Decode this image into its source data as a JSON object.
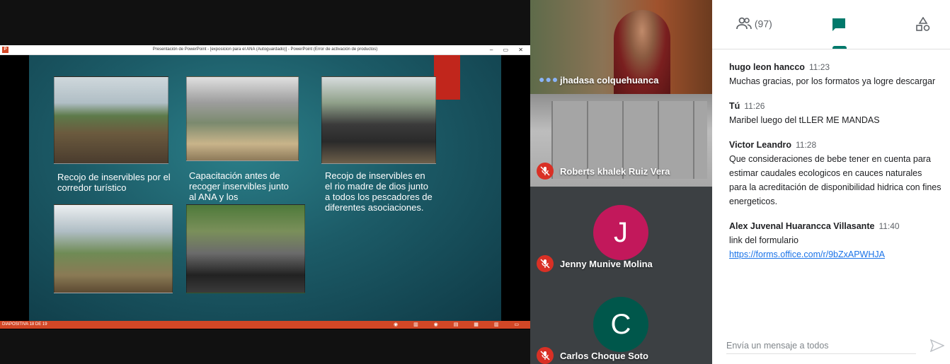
{
  "presentation": {
    "window_title": "Presentación de PowerPoint - [exposicion para el ANA (Autoguardado)] - PowerPoint (Error de activación de productos)",
    "window_controls": "–  ▭  ✕",
    "app_logo": "P",
    "slide_captions": [
      "Recojo de inservibles por el corredor turístico",
      "Capacitación antes de recoger inservibles junto al ANA y los",
      "Recojo de inservibles en el rio madre de dios junto a todos los pescadores de diferentes asociaciones."
    ],
    "status_left": "DIAPOSITIVA 18 DE 19",
    "status_right": "◉ ▥ ◉  ▤ ▦ ▥ ▭"
  },
  "participants": [
    {
      "name": "jhadasa colquehuanca",
      "speaking": true,
      "muted": false
    },
    {
      "name": "Roberts khalek Ruiz Vera",
      "muted": true
    },
    {
      "name": "Jenny Munive Molina",
      "initial": "J",
      "avatar_color": "#c2185b",
      "muted": true
    },
    {
      "name": "Carlos Choque Soto",
      "initial": "C",
      "avatar_color": "#00574b",
      "muted": true
    }
  ],
  "panel": {
    "people_count": "(97)",
    "messages": [
      {
        "sender": "hugo leon hancco",
        "time": "11:23",
        "text": "Muchas gracias, por los formatos ya logre descargar"
      },
      {
        "sender": "Tú",
        "time": "11:26",
        "text": "Maribel luego del tLLER ME MANDAS"
      },
      {
        "sender": "Victor Leandro",
        "time": "11:28",
        "text": "Que consideraciones de bebe tener en cuenta  para estimar caudales ecologicos en cauces naturales para la acreditación de disponibilidad hidrica con fines energeticos."
      },
      {
        "sender": "Alex Juvenal Huarancca Villasante",
        "time": "11:40",
        "text": "link del formulario",
        "link": "https://forms.office.com/r/9bZxAPWHJA"
      }
    ],
    "composer_placeholder": "Envía un mensaje a todos"
  },
  "colors": {
    "accent": "#00796b",
    "muted_red": "#d93025",
    "link": "#1a73e8",
    "ppt_orange": "#d24726"
  }
}
